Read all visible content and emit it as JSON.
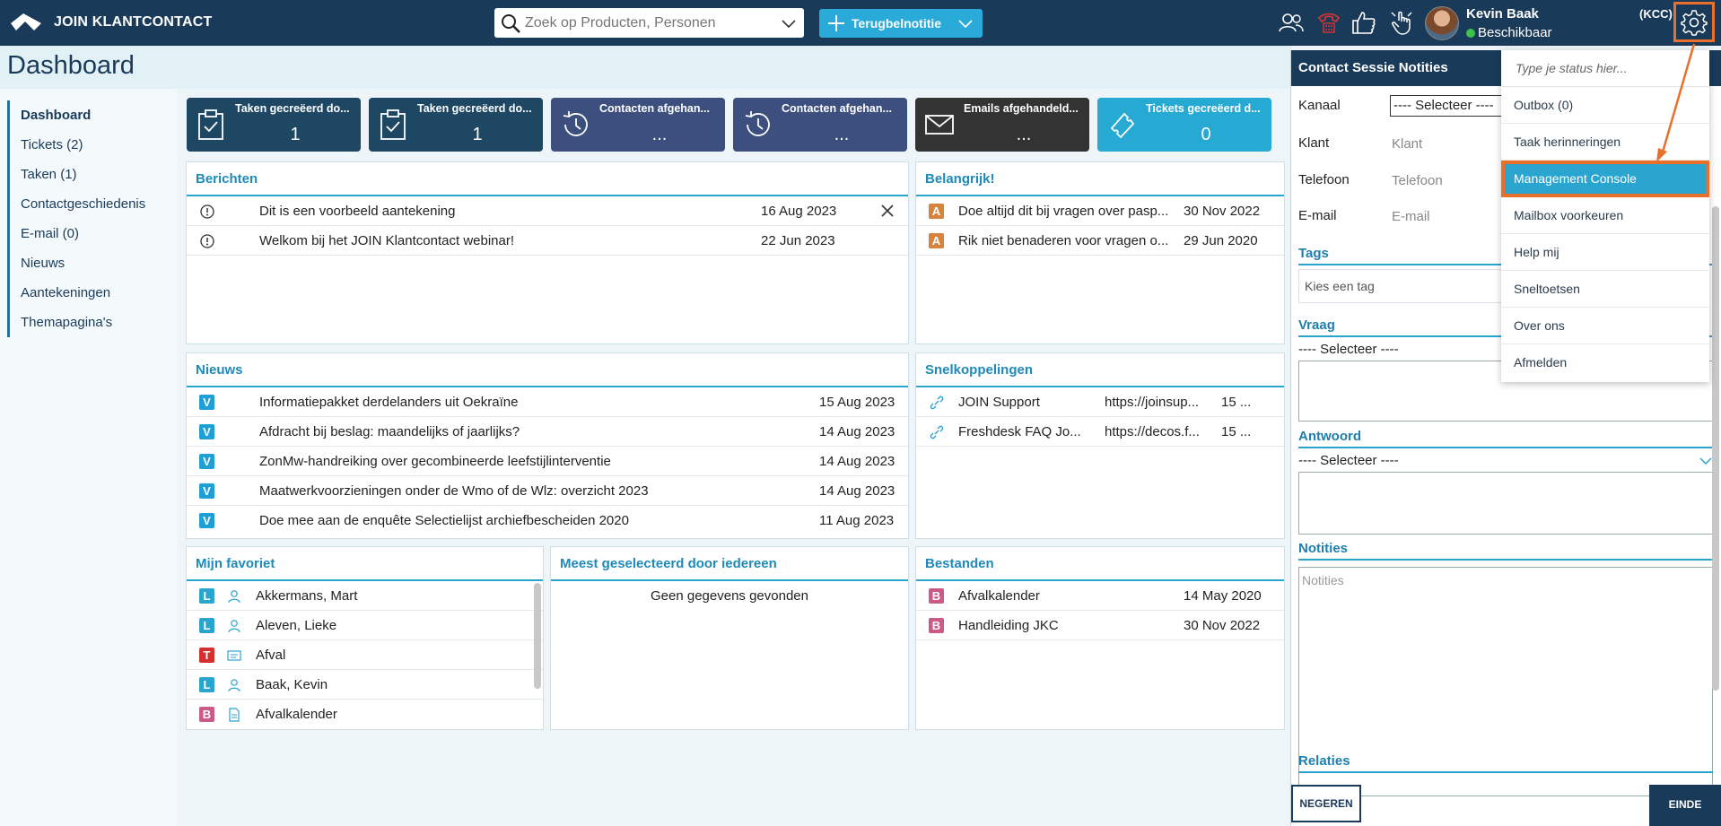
{
  "header": {
    "app_name": "JOIN KLANTCONTACT",
    "search_placeholder": "Zoek op Producten, Personen",
    "quick_button": "Terugbelnotitie",
    "user_name": "Kevin Baak",
    "user_status": "Beschikbaar",
    "tenant": "(KCC)"
  },
  "page": {
    "title": "Dashboard"
  },
  "nav": {
    "items": [
      "Dashboard",
      "Tickets (2)",
      "Taken (1)",
      "Contactgeschiedenis",
      "E-mail (0)",
      "Nieuws",
      "Aantekeningen",
      "Themapagina's"
    ]
  },
  "tiles": [
    {
      "label": "Taken gecreëerd do...",
      "value": "1",
      "color": "#1e4764",
      "icon": "clipboard-check-icon"
    },
    {
      "label": "Taken gecreëerd do...",
      "value": "1",
      "color": "#1e4764",
      "icon": "clipboard-check-icon"
    },
    {
      "label": "Contacten afgehan...",
      "value": "...",
      "color": "#3c4f7e",
      "icon": "history-icon"
    },
    {
      "label": "Contacten afgehan...",
      "value": "...",
      "color": "#3c4f7e",
      "icon": "history-icon"
    },
    {
      "label": "Emails afgehandeld...",
      "value": "...",
      "color": "#333333",
      "icon": "envelope-icon"
    },
    {
      "label": "Tickets gecreëerd d...",
      "value": "0",
      "color": "#26a9d3",
      "icon": "ticket-icon"
    }
  ],
  "berichten": {
    "title": "Berichten",
    "rows": [
      {
        "text": "Dit is een voorbeeld aantekening",
        "date": "16 Aug 2023"
      },
      {
        "text": "Welkom bij het JOIN Klantcontact webinar!",
        "date": "22 Jun 2023"
      }
    ]
  },
  "belangrijk": {
    "title": "Belangrijk!",
    "rows": [
      {
        "badge": "A",
        "text": "Doe altijd dit bij vragen over pasp...",
        "date": "30 Nov 2022"
      },
      {
        "badge": "A",
        "text": "Rik niet benaderen voor vragen o...",
        "date": "29 Jun 2020"
      }
    ]
  },
  "nieuws": {
    "title": "Nieuws",
    "rows": [
      {
        "badge": "V",
        "text": "Informatiepakket derdelanders uit Oekraïne",
        "date": "15 Aug 2023"
      },
      {
        "badge": "V",
        "text": "Afdracht bij beslag: maandelijks of jaarlijks?",
        "date": "14 Aug 2023"
      },
      {
        "badge": "V",
        "text": "ZonMw-handreiking over gecombineerde leefstijlinterventie",
        "date": "14 Aug 2023"
      },
      {
        "badge": "V",
        "text": "Maatwerkvoorzieningen onder de Wmo of de Wlz: overzicht 2023",
        "date": "14 Aug 2023"
      },
      {
        "badge": "V",
        "text": "Doe mee aan de enquête Selectielijst archiefbescheiden 2020",
        "date": "11 Aug 2023"
      }
    ]
  },
  "snelkoppelingen": {
    "title": "Snelkoppelingen",
    "rows": [
      {
        "text": "JOIN Support",
        "url": "https://joinsup...",
        "date": "15 ..."
      },
      {
        "text": "Freshdesk FAQ Jo...",
        "url": "https://decos.f...",
        "date": "15 ..."
      }
    ]
  },
  "favoriet": {
    "title": "Mijn favoriet",
    "rows": [
      {
        "badge": "L",
        "icon": "person-icon",
        "text": "Akkermans, Mart"
      },
      {
        "badge": "L",
        "icon": "person-icon",
        "text": "Aleven, Lieke"
      },
      {
        "badge": "T",
        "icon": "card-icon",
        "text": "Afval"
      },
      {
        "badge": "L",
        "icon": "person-icon",
        "text": "Baak, Kevin"
      },
      {
        "badge": "B",
        "icon": "document-icon",
        "text": "Afvalkalender"
      }
    ]
  },
  "meest": {
    "title": "Meest geselecteerd door iedereen",
    "empty": "Geen gegevens gevonden"
  },
  "bestanden": {
    "title": "Bestanden",
    "rows": [
      {
        "badge": "B",
        "text": "Afvalkalender",
        "date": "14 May 2020"
      },
      {
        "badge": "B",
        "text": "Handleiding JKC",
        "date": "30 Nov 2022"
      }
    ]
  },
  "session": {
    "title": "Contact Sessie Notities",
    "kanaal_label": "Kanaal",
    "kanaal_value": "---- Selecteer ----",
    "klant_label": "Klant",
    "klant_ph": "Klant",
    "telefoon_label": "Telefoon",
    "telefoon_ph": "Telefoon",
    "email_label": "E-mail",
    "email_ph": "E-mail",
    "tags_title": "Tags",
    "tags_ph": "Kies een tag",
    "vraag_title": "Vraag",
    "vraag_select": "---- Selecteer ----",
    "antwoord_title": "Antwoord",
    "antwoord_select": "---- Selecteer ----",
    "notities_title": "Notities",
    "notities_ph": "Notities",
    "relaties_title": "Relaties",
    "negeren": "NEGEREN",
    "einde": "EINDE"
  },
  "menu": {
    "status_placeholder": "Type je status hier...",
    "items": [
      "Outbox (0)",
      "Taak herinneringen",
      "Management Console",
      "Mailbox voorkeuren",
      "Help mij",
      "Sneltoetsen",
      "Over ons",
      "Afmelden"
    ]
  },
  "colors": {
    "topbar": "#1a3a5a",
    "accent": "#2aa5cf",
    "highlight_outline": "#e8702a",
    "badge_A": "#d9823b",
    "badge_V": "#1e9fd6",
    "badge_L": "#2aa5cf",
    "badge_T": "#d62d2d",
    "badge_B": "#cc5a88"
  }
}
